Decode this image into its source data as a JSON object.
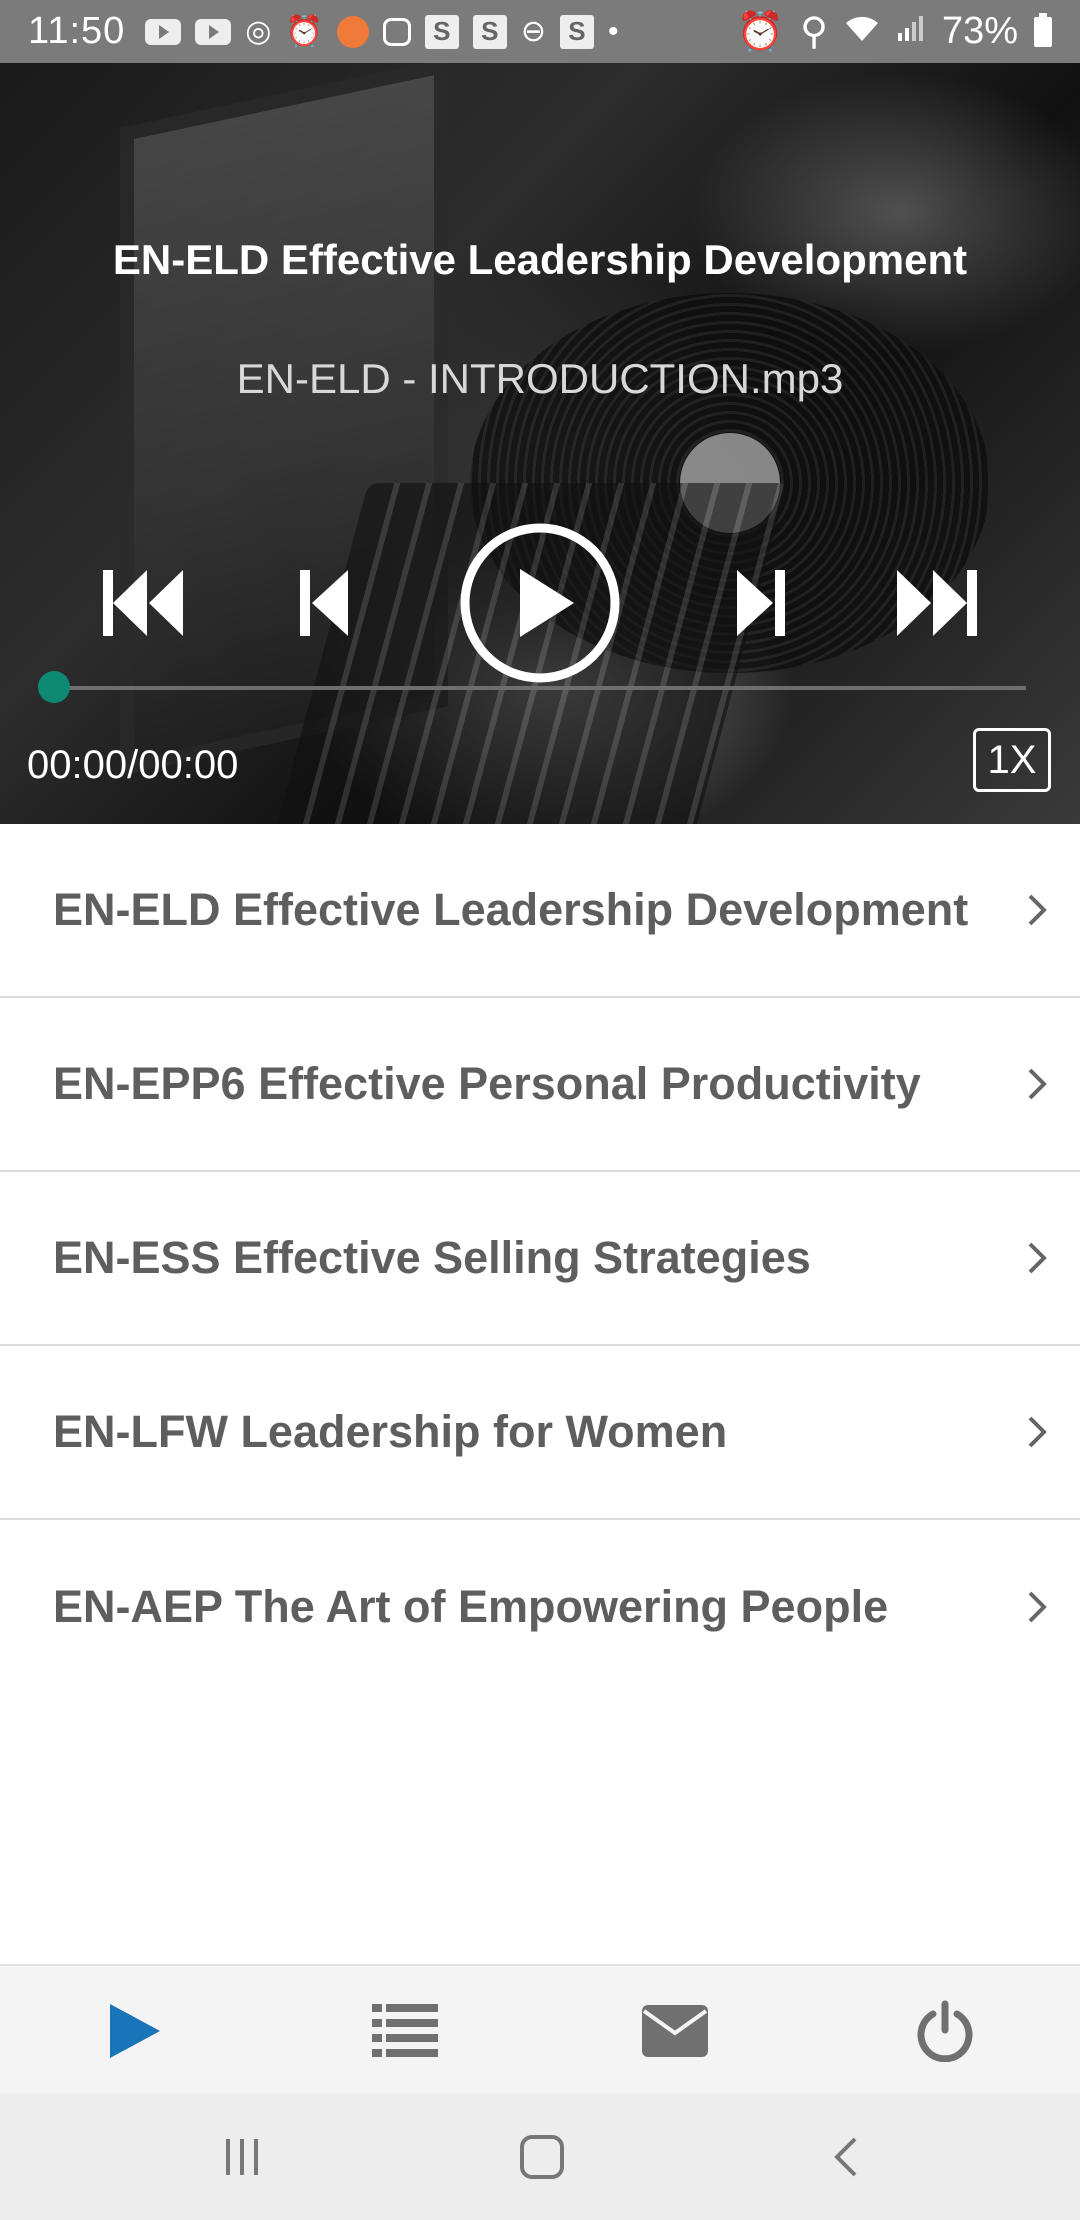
{
  "status_bar": {
    "time": "11:50",
    "battery": "73%"
  },
  "player": {
    "title": "EN-ELD Effective Leadership Development",
    "file": "EN-ELD - INTRODUCTION.mp3",
    "time": "00:00/00:00",
    "speed": "1X",
    "progress": 0,
    "accent_color": "#0e8a73"
  },
  "list": {
    "items": [
      {
        "label": "EN-ELD Effective Leadership Development"
      },
      {
        "label": "EN-EPP6 Effective Personal Productivity"
      },
      {
        "label": "EN-ESS Effective Selling Strategies"
      },
      {
        "label": "EN-LFW Leadership for Women"
      },
      {
        "label": "EN-AEP The Art of Empowering People"
      }
    ]
  },
  "bottom_nav": {
    "active_color": "#1a74b8",
    "icon_color": "#707070",
    "items": [
      "play-icon",
      "list-icon",
      "mail-icon",
      "power-icon"
    ]
  }
}
